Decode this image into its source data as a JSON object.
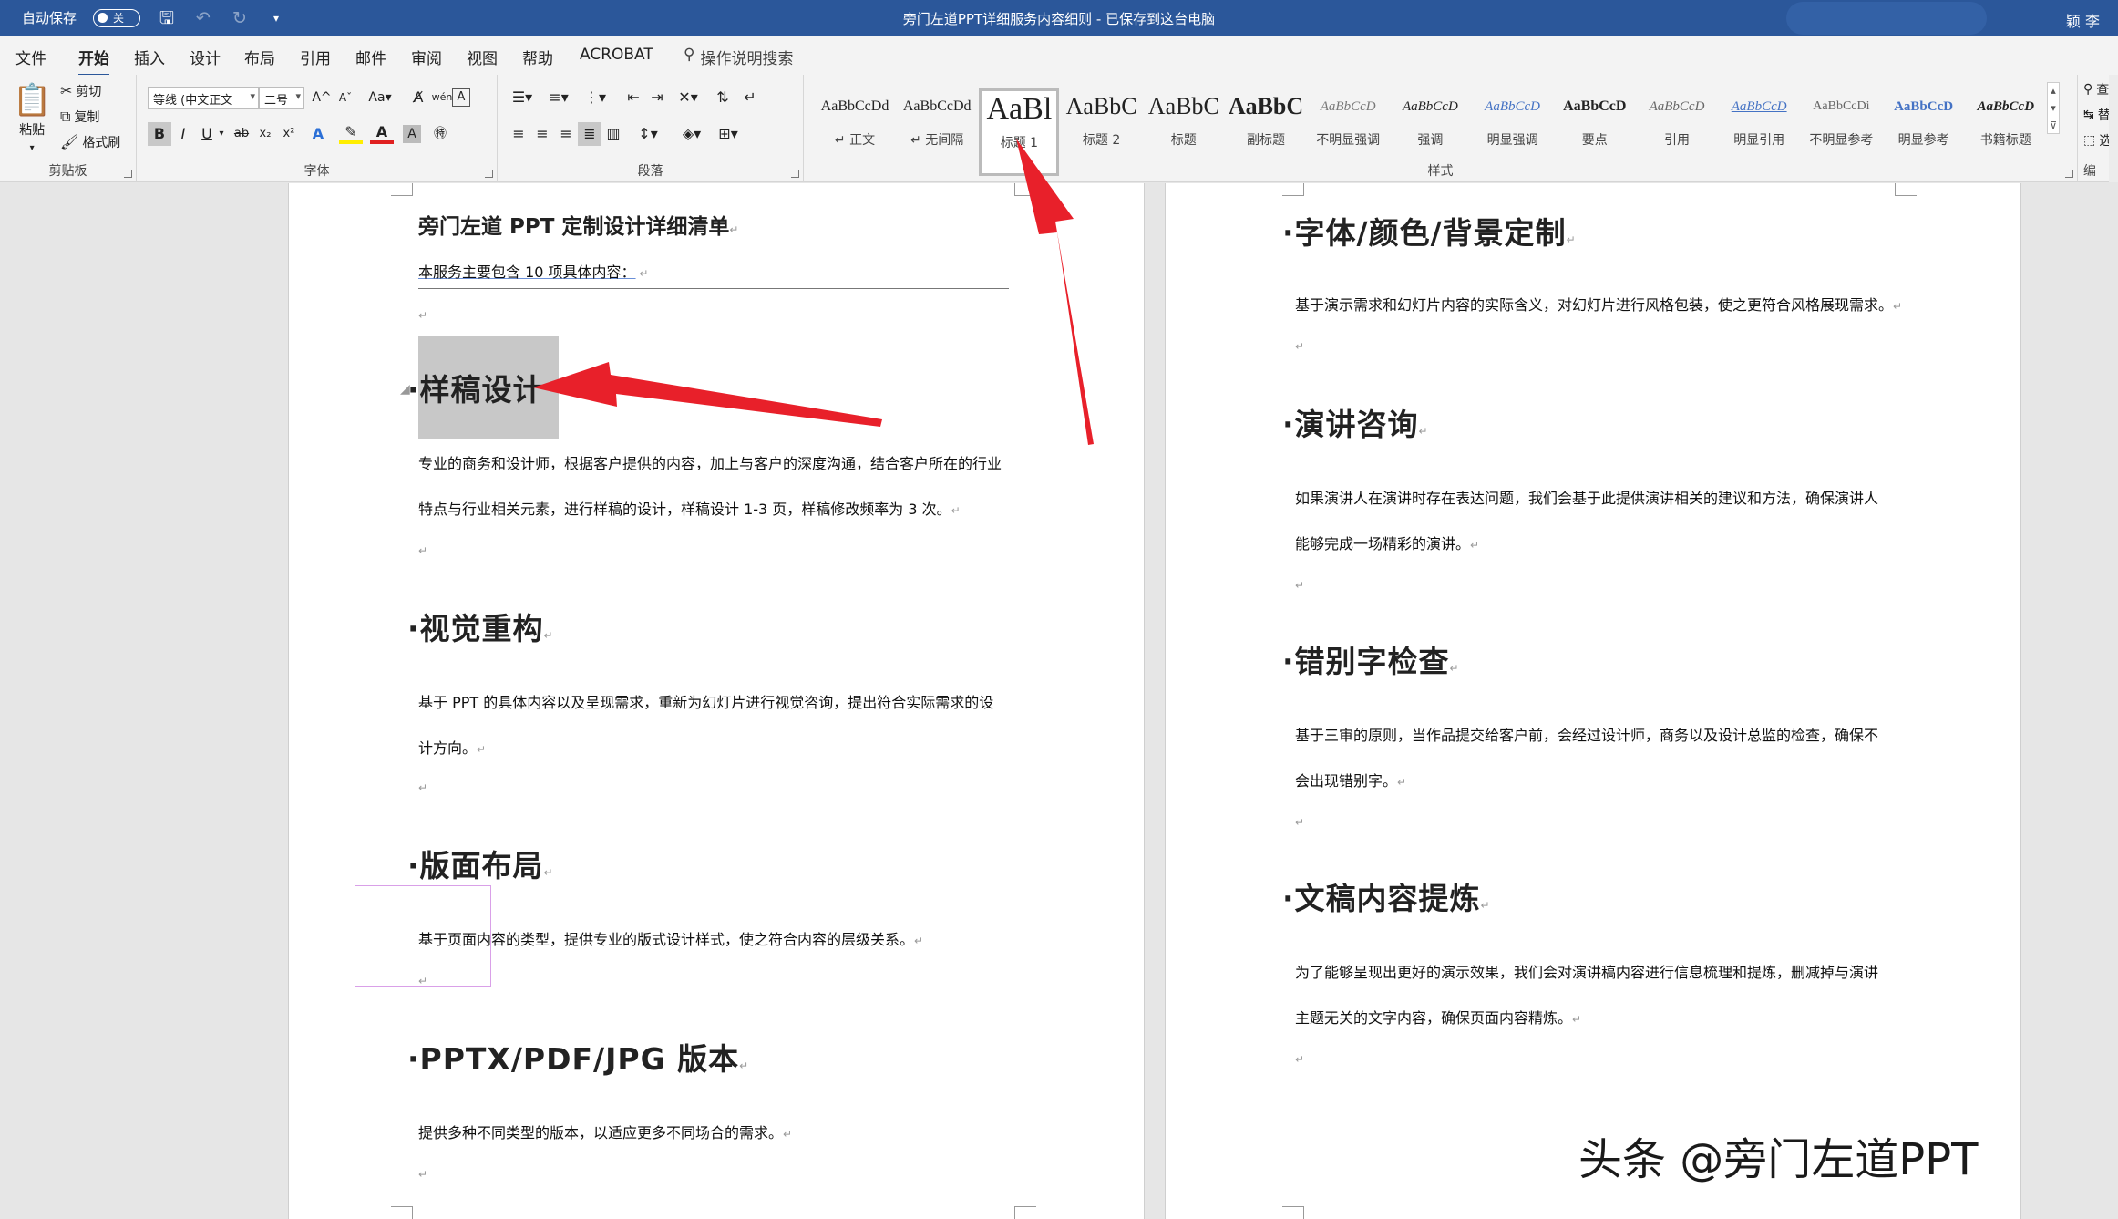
{
  "titlebar": {
    "autosave_label": "自动保存",
    "autosave_state": "关",
    "document_title": "旁门左道PPT详细服务内容细则 - 已保存到这台电脑",
    "user": "颖 李"
  },
  "tabs": [
    "文件",
    "开始",
    "插入",
    "设计",
    "布局",
    "引用",
    "邮件",
    "审阅",
    "视图",
    "帮助",
    "ACROBAT"
  ],
  "active_tab": "开始",
  "tell_me": "操作说明搜索",
  "clipboard": {
    "paste": "粘贴",
    "cut": "剪切",
    "copy": "复制",
    "format_painter": "格式刷",
    "label": "剪贴板"
  },
  "font": {
    "name": "等线 (中文正文",
    "size": "二号",
    "label": "字体"
  },
  "paragraph": {
    "label": "段落"
  },
  "styles": {
    "label": "样式",
    "items": [
      {
        "preview": "AaBbCcDd",
        "name": "↵ 正文"
      },
      {
        "preview": "AaBbCcDd",
        "name": "↵ 无间隔"
      },
      {
        "preview": "AaBl",
        "name": "标题 1"
      },
      {
        "preview": "AaBbC",
        "name": "标题 2"
      },
      {
        "preview": "AaBbC",
        "name": "标题"
      },
      {
        "preview": "AaBbC",
        "name": "副标题"
      },
      {
        "preview": "AaBbCcD",
        "name": "不明显强调"
      },
      {
        "preview": "AaBbCcD",
        "name": "强调"
      },
      {
        "preview": "AaBbCcD",
        "name": "明显强调"
      },
      {
        "preview": "AaBbCcD",
        "name": "要点"
      },
      {
        "preview": "AaBbCcD",
        "name": "引用"
      },
      {
        "preview": "AaBbCcD",
        "name": "明显引用"
      },
      {
        "preview": "AaBbCcDi",
        "name": "不明显参考"
      },
      {
        "preview": "AaBbCcD",
        "name": "明显参考"
      },
      {
        "preview": "AaBbCcD",
        "name": "书籍标题"
      }
    ]
  },
  "editing_partial": [
    "查",
    "替",
    "选",
    "编"
  ],
  "left_page": {
    "title": "旁门左道 PPT 定制设计详细清单",
    "intro": "本服务主要包含 10 项具体内容：",
    "sections": [
      {
        "heading": "样稿设计",
        "lines": [
          "专业的商务和设计师，根据客户提供的内容，加上与客户的深度沟通，结合客户所在的行业",
          "特点与行业相关元素，进行样稿的设计，样稿设计 1-3 页，样稿修改频率为 3 次。"
        ]
      },
      {
        "heading": "视觉重构",
        "lines": [
          "基于 PPT 的具体内容以及呈现需求，重新为幻灯片进行视觉咨询，提出符合实际需求的设",
          "计方向。"
        ]
      },
      {
        "heading": "版面布局",
        "lines": [
          "基于页面内容的类型，提供专业的版式设计样式，使之符合内容的层级关系。"
        ]
      },
      {
        "heading": "PPTX/PDF/JPG 版本",
        "lines": [
          "提供多种不同类型的版本，以适应更多不同场合的需求。"
        ]
      }
    ]
  },
  "right_page": {
    "sections": [
      {
        "heading": "字体/颜色/背景定制",
        "lines": [
          "基于演示需求和幻灯片内容的实际含义，对幻灯片进行风格包装，使之更符合风格展现需求。"
        ]
      },
      {
        "heading": "演讲咨询",
        "lines": [
          "如果演讲人在演讲时存在表达问题，我们会基于此提供演讲相关的建议和方法，确保演讲人",
          "能够完成一场精彩的演讲。"
        ]
      },
      {
        "heading": "错别字检查",
        "lines": [
          "基于三审的原则，当作品提交给客户前，会经过设计师，商务以及设计总监的检查，确保不",
          "会出现错别字。"
        ]
      },
      {
        "heading": "文稿内容提炼",
        "lines": [
          "为了能够呈现出更好的演示效果，我们会对演讲稿内容进行信息梳理和提炼，删减掉与演讲",
          "主题无关的文字内容，确保页面内容精炼。"
        ]
      }
    ]
  },
  "watermark": "头条 @旁门左道PPT",
  "colors": {
    "titlebar": "#2b579a",
    "arrow": "#e8202a",
    "highlight": "#c8c8c8"
  }
}
